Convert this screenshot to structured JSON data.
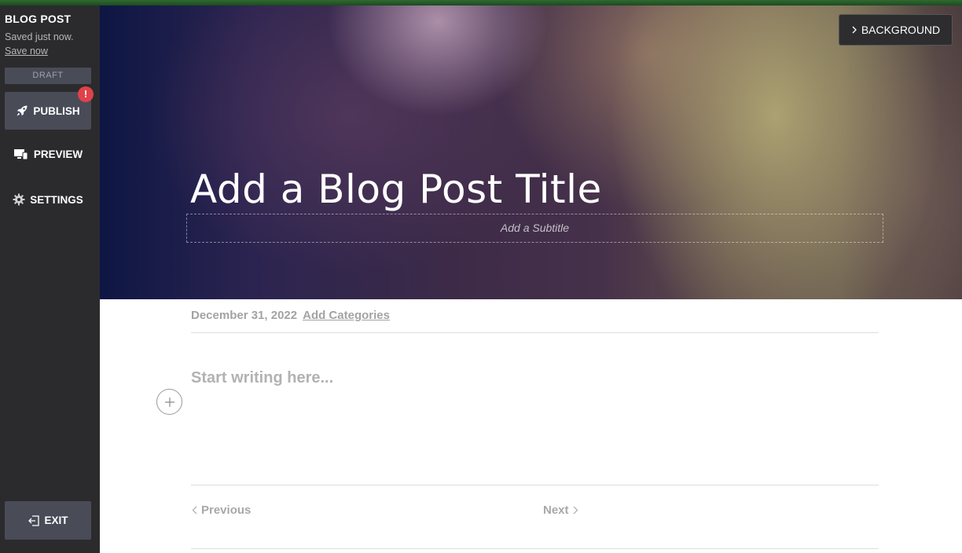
{
  "sidebar": {
    "title": "BLOG POST",
    "saved_status": "Saved just now.",
    "save_now": "Save now",
    "status_badge": "DRAFT",
    "publish_label": "PUBLISH",
    "publish_alert": "!",
    "preview_label": "PREVIEW",
    "settings_label": "SETTINGS",
    "exit_label": "EXIT"
  },
  "hero": {
    "background_button": "BACKGROUND",
    "title_placeholder": "Add a Blog Post Title",
    "subtitle_placeholder": "Add a Subtitle"
  },
  "post": {
    "date": "December 31, 2022",
    "add_categories": "Add Categories",
    "body_placeholder": "Start writing here..."
  },
  "pagination": {
    "previous": "Previous",
    "next": "Next"
  },
  "colors": {
    "sidebar_bg": "#2b2b2d",
    "button_bg": "#494b57",
    "alert_red": "#e0424a",
    "top_accent": "#2f6a2f"
  },
  "icons": {
    "publish": "rocket-icon",
    "preview": "devices-icon",
    "settings": "gear-icon",
    "exit": "exit-icon",
    "background": "chevron-right-icon",
    "add_block": "plus-icon"
  }
}
